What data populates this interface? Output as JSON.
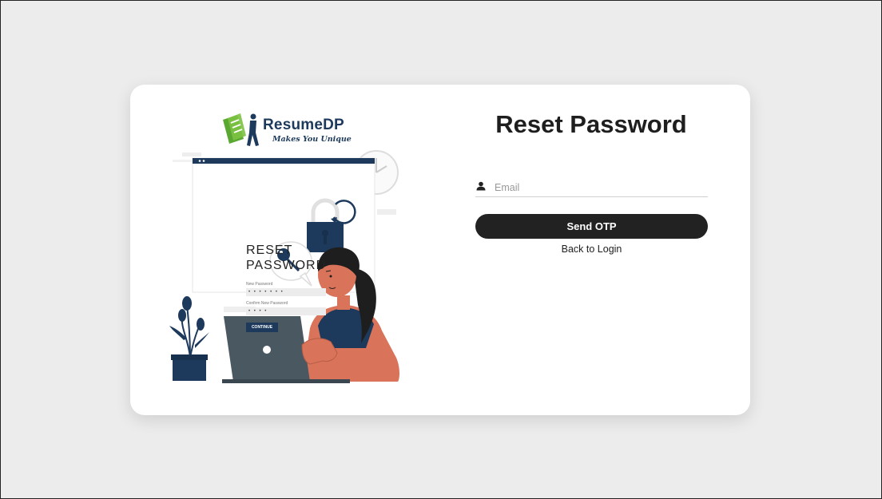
{
  "logo": {
    "name": "ResumeDP",
    "tagline": "Makes You Unique"
  },
  "illustration": {
    "title": "RESET\nPASSWORD",
    "new_password_label": "New Password",
    "new_password_value": "• • • • • • •",
    "confirm_label": "Confirm New Password",
    "confirm_value": "• • • •",
    "continue_label": "CONTINUE"
  },
  "form": {
    "title": "Reset Password",
    "email_placeholder": "Email",
    "email_value": "",
    "send_button": "Send OTP",
    "back_link": "Back to Login"
  },
  "icons": {
    "user": "user-icon"
  },
  "colors": {
    "primary_button": "#222222",
    "brand_blue": "#1d3a5c",
    "brand_green": "#5aa832",
    "skin": "#d9735a"
  }
}
